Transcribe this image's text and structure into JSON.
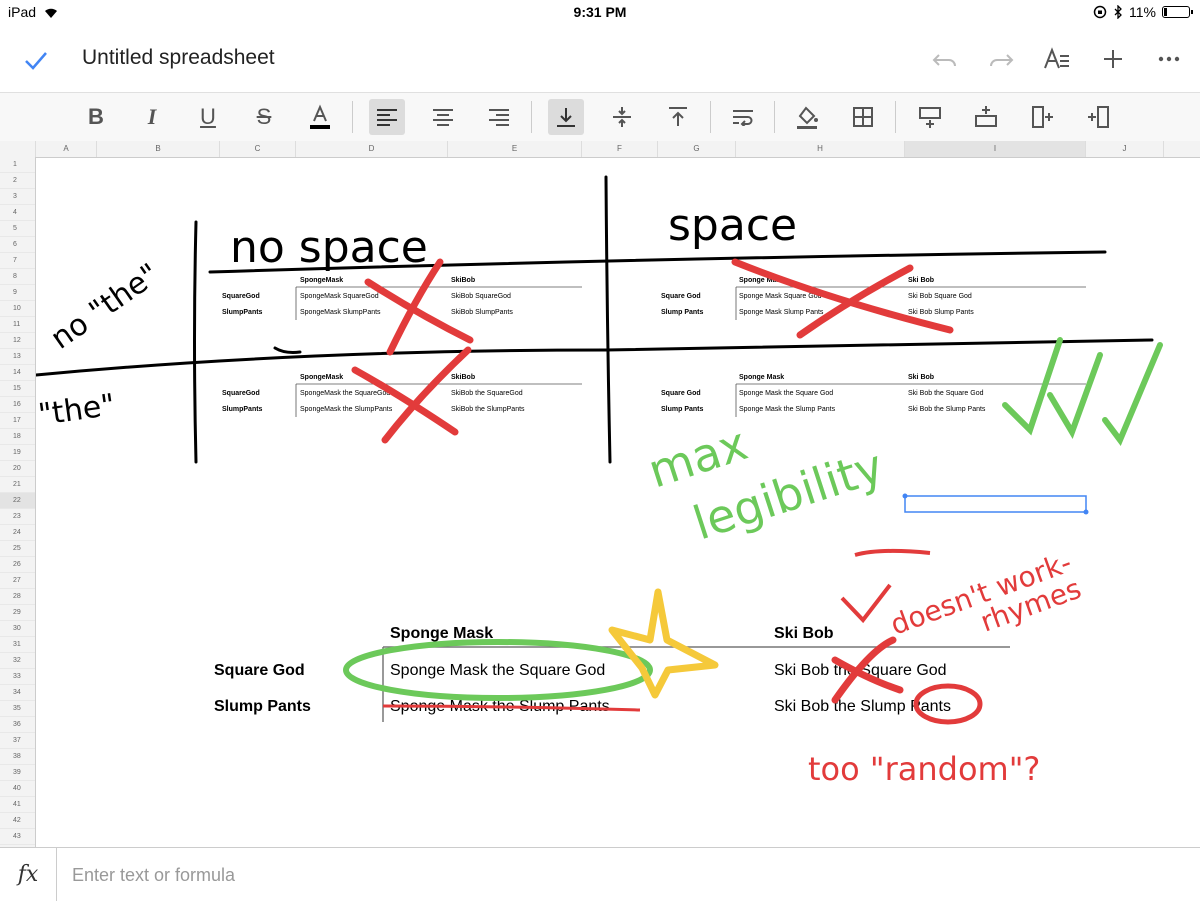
{
  "status_bar": {
    "device": "iPad",
    "time": "9:31 PM",
    "battery": "11%",
    "battery_level": 0.11
  },
  "app_bar": {
    "title": "Untitled spreadsheet",
    "icons": [
      "check-icon",
      "undo-icon",
      "redo-icon",
      "text-format-icon",
      "add-icon",
      "more-icon"
    ]
  },
  "toolbar": {
    "icons": [
      "bold-icon",
      "italic-icon",
      "underline-icon",
      "strikethrough-icon",
      "text-color-icon",
      "align-left-icon",
      "align-center-icon",
      "align-right-icon",
      "valign-bottom-icon",
      "valign-middle-icon",
      "valign-top-icon",
      "wrap-icon",
      "fill-color-icon",
      "borders-icon",
      "insert-row-above-icon",
      "insert-row-below-icon",
      "insert-column-left-icon",
      "insert-column-right-icon"
    ]
  },
  "columns": [
    "A",
    "B",
    "C",
    "D",
    "E",
    "F",
    "G",
    "H",
    "I",
    "J"
  ],
  "rows": [
    "1",
    "2",
    "3",
    "4",
    "5",
    "6",
    "7",
    "8",
    "9",
    "10",
    "11",
    "12",
    "13",
    "14",
    "15",
    "16",
    "17",
    "18",
    "19",
    "20",
    "21",
    "22",
    "23",
    "24",
    "25",
    "26",
    "27",
    "28",
    "29",
    "30",
    "31",
    "32",
    "33",
    "34",
    "35",
    "36",
    "37",
    "38",
    "39",
    "40",
    "41",
    "42",
    "43"
  ],
  "selected": {
    "column": "I",
    "row": "22"
  },
  "tables": {
    "nospace_nothe": {
      "headers": [
        "SpongeMask",
        "SkiBob"
      ],
      "rows": [
        [
          "SquareGod",
          "SpongeMask SquareGod",
          "SkiBob SquareGod"
        ],
        [
          "SlumpPants",
          "SpongeMask SlumpPants",
          "SkiBob SlumpPants"
        ]
      ]
    },
    "space_nothe": {
      "headers": [
        "Sponge Mask",
        "Ski Bob"
      ],
      "rows": [
        [
          "Square God",
          "Sponge Mask Square God",
          "Ski Bob Square God"
        ],
        [
          "Slump Pants",
          "Sponge Mask Slump Pants",
          "Ski Bob Slump Pants"
        ]
      ]
    },
    "nospace_the": {
      "headers": [
        "SpongeMask",
        "SkiBob"
      ],
      "rows": [
        [
          "SquareGod",
          "SpongeMask the SquareGod",
          "SkiBob the SquareGod"
        ],
        [
          "SlumpPants",
          "SpongeMask the SlumpPants",
          "SkiBob the SlumpPants"
        ]
      ]
    },
    "space_the": {
      "headers": [
        "Sponge Mask",
        "Ski Bob"
      ],
      "rows": [
        [
          "Square God",
          "Sponge Mask the Square God",
          "Ski Bob the Square God"
        ],
        [
          "Slump Pants",
          "Sponge Mask the Slump Pants",
          "Ski Bob the Slump Pants"
        ]
      ]
    },
    "large": {
      "headers": [
        "Sponge Mask",
        "Ski Bob"
      ],
      "rows": [
        [
          "Square God",
          "Sponge Mask the Square God",
          "Ski Bob the Square God"
        ],
        [
          "Slump Pants",
          "Sponge Mask the Slump Pants",
          "Ski Bob the Slump Pants"
        ]
      ]
    }
  },
  "annotations": {
    "no_space": "no space",
    "space": "space",
    "no_the": "no \"the\"",
    "the": "\"the\"",
    "max_legibility": [
      "max",
      "legibility"
    ],
    "doesnt_work": "doesn't work-",
    "rhymes": "rhymes",
    "too_random": "too \"random\"?"
  },
  "formula_bar": {
    "label": "fx",
    "placeholder": "Enter text or formula"
  },
  "colors": {
    "accent": "#4285f4",
    "red_ink": "#e23b3b",
    "green_ink": "#6cc95a",
    "yellow_ink": "#f5c93a"
  }
}
